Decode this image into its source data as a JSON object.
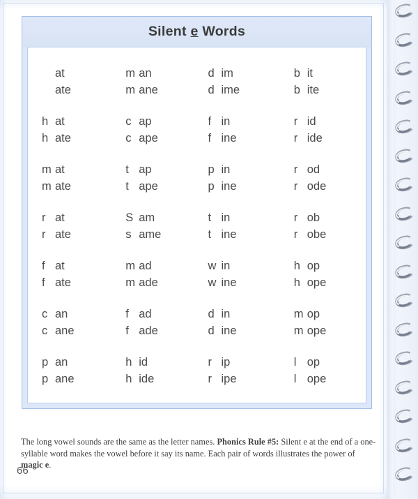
{
  "page": {
    "number": "66",
    "title_prefix": "Silent ",
    "title_underlined": "e",
    "title_suffix": " Words",
    "title_full": "Silent e Words"
  },
  "colors": {
    "header_band": "#dce7f7",
    "frame_border": "#a6c0e6",
    "inner_border": "#b9cdec",
    "title_text": "#3b3b3b",
    "word_text": "#4a4a4a",
    "footer_text": "#403f3f",
    "binding_metal": "#9aa3b2"
  },
  "word_grid": {
    "columns": 4,
    "rows": 7,
    "cells": [
      [
        {
          "onset": "",
          "short": "at",
          "long": "ate"
        },
        {
          "onset": "m",
          "short": "an",
          "long": "ane"
        },
        {
          "onset": "d",
          "short": "im",
          "long": "ime"
        },
        {
          "onset": "b",
          "short": "it",
          "long": "ite"
        }
      ],
      [
        {
          "onset": "h",
          "short": "at",
          "long": "ate"
        },
        {
          "onset": "c",
          "short": "ap",
          "long": "ape"
        },
        {
          "onset": "f",
          "short": "in",
          "long": "ine"
        },
        {
          "onset": "r",
          "short": "id",
          "long": "ide"
        }
      ],
      [
        {
          "onset": "m",
          "short": "at",
          "long": "ate"
        },
        {
          "onset": "t",
          "short": "ap",
          "long": "ape"
        },
        {
          "onset": "p",
          "short": "in",
          "long": "ine"
        },
        {
          "onset": "r",
          "short": "od",
          "long": "ode"
        }
      ],
      [
        {
          "onset": "r",
          "onset_long": "r",
          "short": "at",
          "long": "ate"
        },
        {
          "onset": "S",
          "onset_long": "s",
          "short": "am",
          "long": "ame"
        },
        {
          "onset": "t",
          "onset_long": "t",
          "short": "in",
          "long": "ine"
        },
        {
          "onset": "r",
          "onset_long": "r",
          "short": "ob",
          "long": "obe"
        }
      ],
      [
        {
          "onset": "f",
          "short": "at",
          "long": "ate"
        },
        {
          "onset": "m",
          "short": "ad",
          "long": "ade"
        },
        {
          "onset": "w",
          "short": "in",
          "long": "ine"
        },
        {
          "onset": "h",
          "short": "op",
          "long": "ope"
        }
      ],
      [
        {
          "onset": "c",
          "short": "an",
          "long": "ane"
        },
        {
          "onset": "f",
          "short": "ad",
          "long": "ade"
        },
        {
          "onset": "d",
          "short": "in",
          "long": "ine"
        },
        {
          "onset": "m",
          "short": "op",
          "long": "ope"
        }
      ],
      [
        {
          "onset": "p",
          "short": "an",
          "long": "ane"
        },
        {
          "onset": "h",
          "short": "id",
          "long": "ide"
        },
        {
          "onset": "r",
          "short": "ip",
          "long": "ipe"
        },
        {
          "onset": "l",
          "short": "op",
          "long": "ope"
        }
      ]
    ]
  },
  "footer": {
    "text_1": "The long vowel sounds are the same as the letter names. ",
    "bold_1": "Phonics Rule #5:",
    "text_2": " Silent e at the end of a one-syllable word makes the vowel before it say its name. Each pair of words illustrates the power of ",
    "bold_2": "magic e",
    "text_3": ".",
    "full": "The long vowel sounds are the same as the letter names. Phonics Rule #5: Silent e at the end of a one-syllable word makes the vowel before it say its name. Each pair of words illustrates the power of magic e."
  },
  "binding": {
    "ring_count": 17,
    "icon": "spiral-coil-ring"
  }
}
